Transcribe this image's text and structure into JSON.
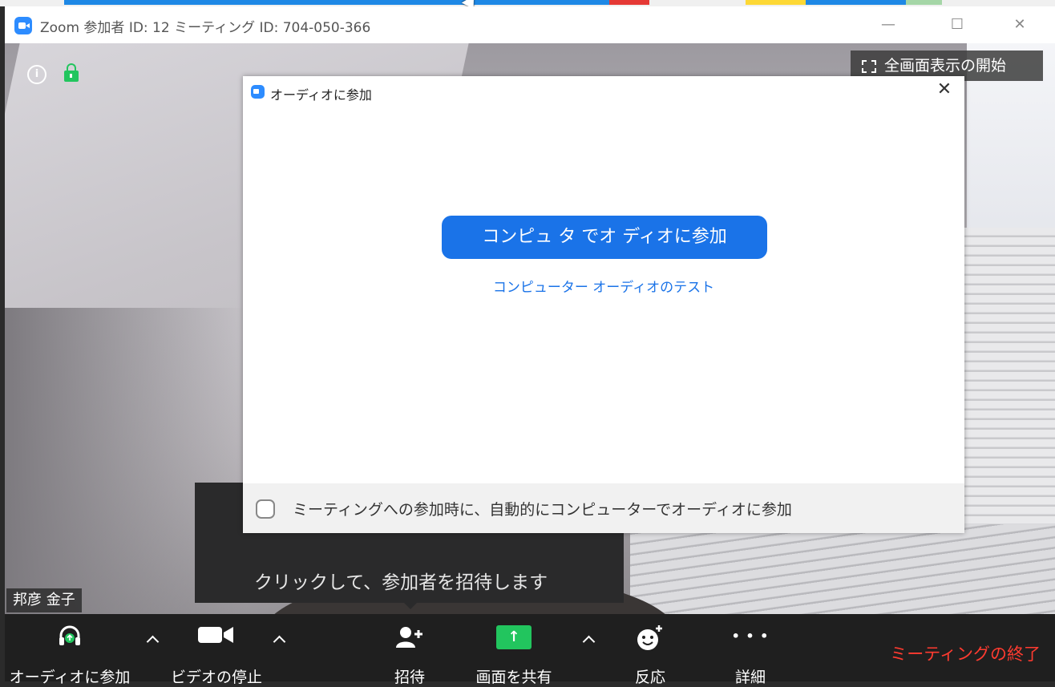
{
  "window": {
    "title": "Zoom 参加者 ID: 12 ミーティング ID: 704-050-366",
    "minimize": "—",
    "maximize": "☐",
    "close": "✕"
  },
  "video": {
    "info_icon": "i",
    "fullscreen_label": "全画面表示の開始",
    "participant_name": "邦彦 金子",
    "invite_tooltip": "クリックして、参加者を招待します"
  },
  "dialog": {
    "title": "オーディオに参加",
    "close": "✕",
    "join_button": "コンピュ タ でオ ディオに参加",
    "test_link": "コンピューター オーディオのテスト",
    "auto_join_checkbox_label": "ミーティングへの参加時に、自動的にコンピューターでオーディオに参加",
    "auto_join_checked": false
  },
  "toolbar": {
    "audio_label": "オーディオに参加",
    "video_label": "ビデオの停止",
    "invite_label": "招待",
    "share_label": "画面を共有",
    "reactions_label": "反応",
    "more_label": "詳細",
    "more_glyph": "• • •",
    "share_glyph": "↑",
    "end_label": "ミーティングの終了"
  },
  "colors": {
    "zoom_blue": "#2d8cff",
    "button_blue": "#1a73e8",
    "share_green": "#22c55e",
    "end_red": "#ff3b30"
  }
}
